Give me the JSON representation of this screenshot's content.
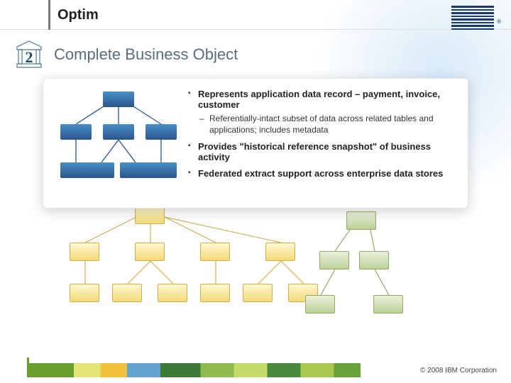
{
  "header": {
    "product": "Optim",
    "brand": "IBM",
    "registered": "®"
  },
  "title_row": {
    "number": "2",
    "title": "Complete Business Object"
  },
  "bullets": {
    "b1": "Represents application data record – payment, invoice, customer",
    "b1_sub1": "Referentially-intact subset of data across related tables and applications; includes metadata",
    "b2": "Provides \"historical reference snapshot\" of business activity",
    "b3": "Federated  extract support across enterprise data stores"
  },
  "footer": {
    "copyright": "© 2008 IBM Corporation"
  }
}
